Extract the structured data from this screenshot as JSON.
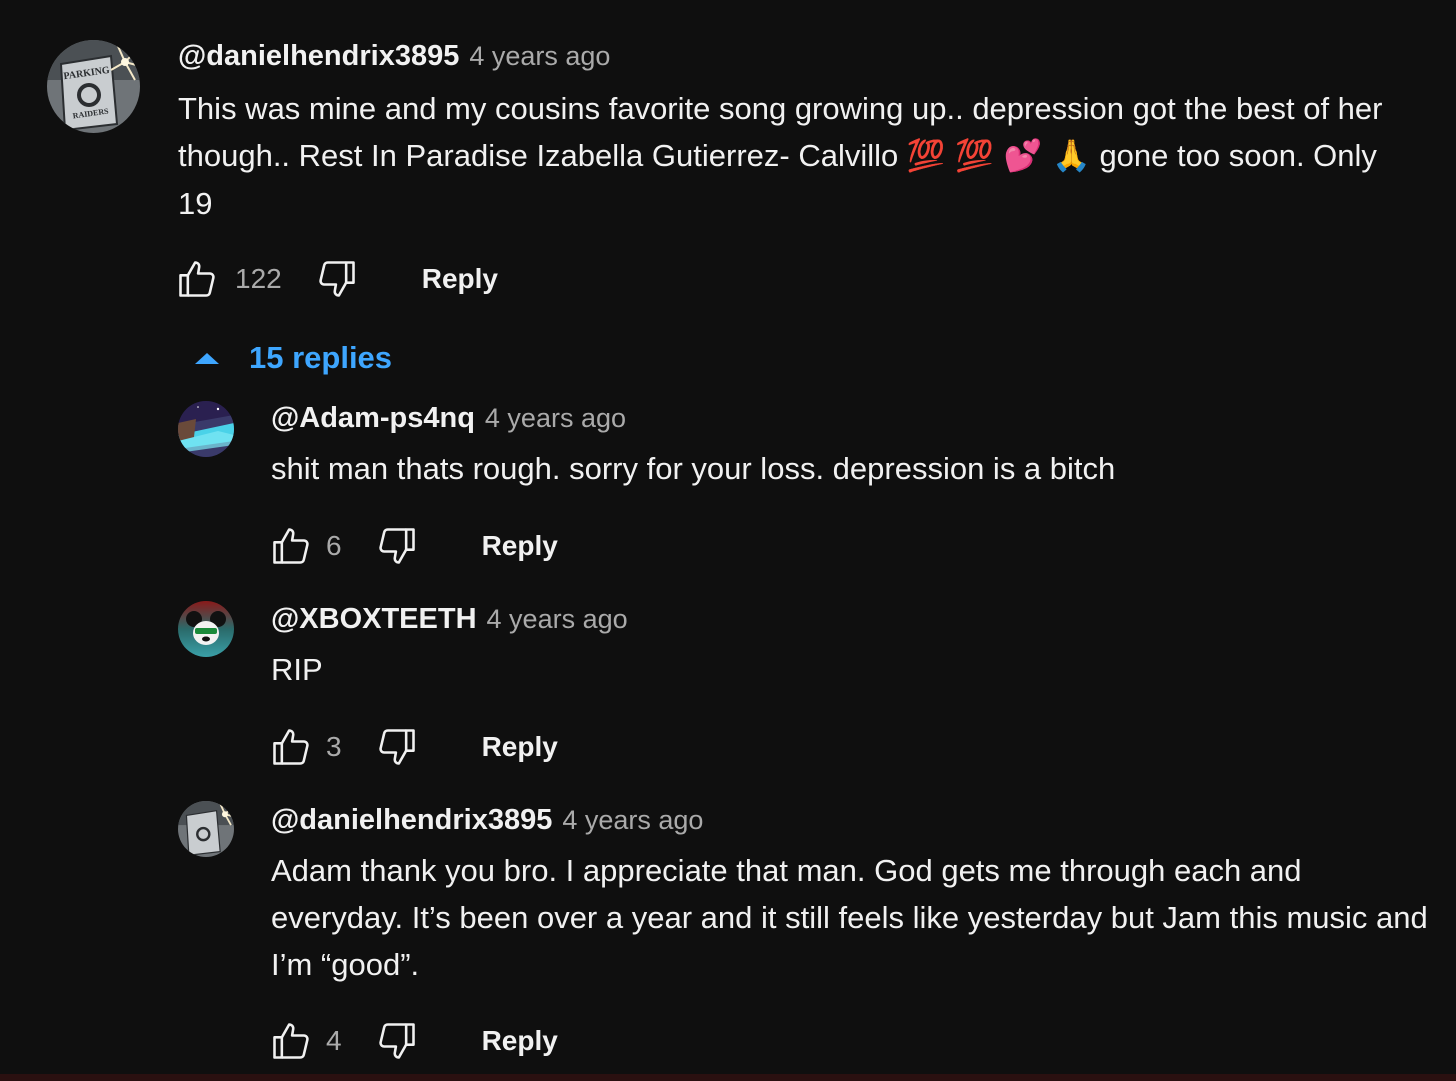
{
  "thread": {
    "comment": {
      "author": "@danielhendrix3895",
      "time": "4 years ago",
      "text_part1": "This was mine and my cousins favorite song growing up.. depression got the best of her though.. Rest In Paradise Izabella Gutierrez- Calvillo ",
      "emojis": "💯 💯 💕 🙏",
      "text_part2": " gone too soon. Only 19",
      "likes": "122",
      "reply_label": "Reply",
      "avatar_icon": "raiders-parking-sign-avatar"
    },
    "replies_toggle": {
      "label": "15 replies",
      "icon": "caret-up-icon",
      "color": "#3ea6ff"
    },
    "replies": [
      {
        "author": "@Adam-ps4nq",
        "time": "4 years ago",
        "text": "shit man thats rough. sorry for your loss. depression is a bitch",
        "likes": "6",
        "reply_label": "Reply",
        "avatar_icon": "night-landscape-avatar"
      },
      {
        "author": "@XBOXTEETH",
        "time": "4 years ago",
        "text": "RIP",
        "likes": "3",
        "reply_label": "Reply",
        "avatar_icon": "cartoon-mouse-avatar"
      },
      {
        "author": "@danielhendrix3895",
        "time": "4 years ago",
        "text": "Adam thank you bro. I appreciate that man. God gets me through each and everyday. It’s been over a year and it still feels like yesterday but Jam this music and I’m “good”.",
        "likes": "4",
        "reply_label": "Reply",
        "avatar_icon": "raiders-parking-sign-avatar"
      }
    ]
  },
  "colors": {
    "background": "#0f0f0f",
    "text_primary": "#f1f1f1",
    "text_secondary": "#aaaaaa",
    "link_blue": "#3ea6ff"
  }
}
